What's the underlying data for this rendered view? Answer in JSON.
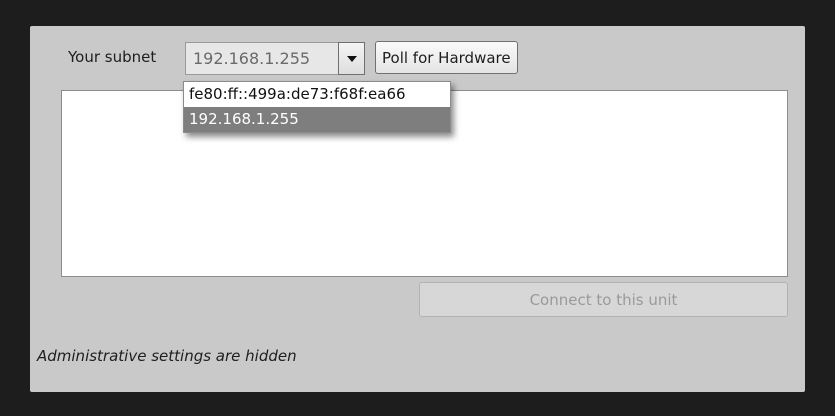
{
  "subnet": {
    "label": "Your subnet",
    "selected_value": "192.168.1.255",
    "options": [
      "fe80:ff::499a:de73:f68f:ea66",
      "192.168.1.255"
    ],
    "selected_index": 1,
    "arrow_icon": "chevron-down-icon"
  },
  "toolbar": {
    "poll_label": "Poll for Hardware"
  },
  "device_list": {
    "items": []
  },
  "connect": {
    "label": "Connect to this unit",
    "enabled": false
  },
  "status": {
    "admin_note": "Administrative settings are hidden"
  }
}
